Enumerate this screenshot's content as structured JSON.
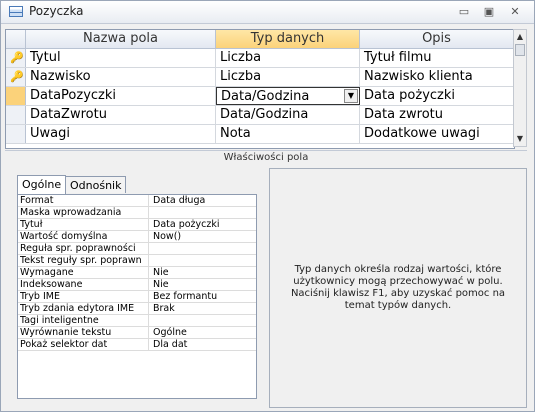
{
  "window": {
    "title": "Pozyczka",
    "icon": "table-icon",
    "buttons": [
      "minimize-icon",
      "maximize-icon",
      "close-icon"
    ]
  },
  "grid": {
    "columns": [
      "Nazwa pola",
      "Typ danych",
      "Opis"
    ],
    "rows": [
      {
        "field": "Tytul",
        "type": "Liczba",
        "desc": "Tytuł filmu",
        "key": true
      },
      {
        "field": "Nazwisko",
        "type": "Liczba",
        "desc": "Nazwisko klienta",
        "key": true
      },
      {
        "field": "DataPozyczki",
        "type": "Data/Godzina",
        "desc": "Data pożyczki",
        "key": false,
        "current": true
      },
      {
        "field": "DataZwrotu",
        "type": "Data/Godzina",
        "desc": "Data zwrotu",
        "key": false
      },
      {
        "field": "Uwagi",
        "type": "Nota",
        "desc": "Dodatkowe uwagi",
        "key": false
      }
    ]
  },
  "properties_title": "Właściwości pola",
  "tabs": [
    "Ogólne",
    "Odnośnik"
  ],
  "properties": [
    {
      "name": "Format",
      "value": "Data długa"
    },
    {
      "name": "Maska wprowadzania",
      "value": ""
    },
    {
      "name": "Tytuł",
      "value": "Data pożyczki"
    },
    {
      "name": "Wartość domyślna",
      "value": "Now()"
    },
    {
      "name": "Reguła spr. poprawności",
      "value": ""
    },
    {
      "name": "Tekst reguły spr. poprawn",
      "value": ""
    },
    {
      "name": "Wymagane",
      "value": "Nie"
    },
    {
      "name": "Indeksowane",
      "value": "Nie"
    },
    {
      "name": "Tryb IME",
      "value": "Bez formantu"
    },
    {
      "name": "Tryb zdania edytora IME",
      "value": "Brak"
    },
    {
      "name": "Tagi inteligentne",
      "value": ""
    },
    {
      "name": "Wyrównanie tekstu",
      "value": "Ogólne"
    },
    {
      "name": "Pokaż selektor dat",
      "value": "Dla dat"
    }
  ],
  "help_text": "Typ danych określa rodzaj wartości, które użytkownicy mogą przechowywać w polu. Naciśnij klawisz F1, aby uzyskać pomoc na temat typów danych.",
  "colors": {
    "selected_header": "#fbd27a",
    "border": "#8e9bb0"
  }
}
